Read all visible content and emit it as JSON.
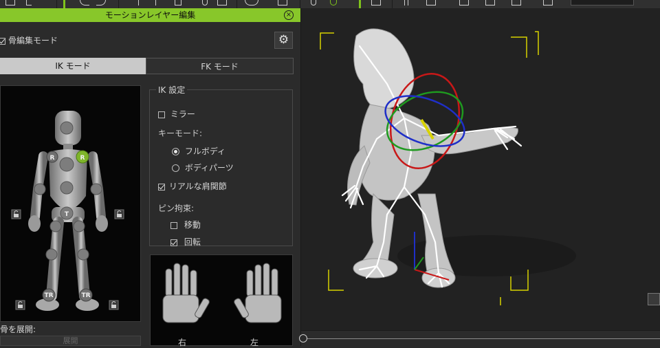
{
  "panel": {
    "title": "モーションレイヤー編集",
    "bone_edit_mode_label": "骨編集モード",
    "tabs": [
      {
        "label": "IK モード",
        "active": true
      },
      {
        "label": "FK モード",
        "active": false
      }
    ],
    "figure_markers": {
      "r_left": "R",
      "r_right": "R",
      "t": "T",
      "tr_left": "TR",
      "tr_right": "TR"
    },
    "ik_settings": {
      "title": "IK 設定",
      "mirror_label": "ミラー",
      "key_mode_label": "キーモード:",
      "key_mode_options": [
        {
          "label": "フルボディ",
          "selected": true
        },
        {
          "label": "ボディパーツ",
          "selected": false
        }
      ],
      "realistic_shoulder_label": "リアルな肩関節",
      "pin_constraint_label": "ピン拘束:",
      "pin_move_label": "移動",
      "pin_rotate_label": "回転"
    },
    "hands": {
      "right_label": "右",
      "left_label": "左"
    },
    "expand_bones_label": "骨を展開:",
    "expand_button_label": "展開"
  },
  "colors": {
    "accent": "#88c72a",
    "selected_joint": "#7fb52a"
  }
}
